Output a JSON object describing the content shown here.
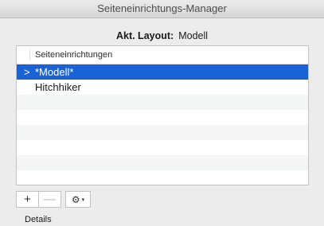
{
  "window": {
    "title": "Seiteneinrichtungs-Manager"
  },
  "current_layout": {
    "label": "Akt. Layout:",
    "value": "Modell"
  },
  "list": {
    "column_header": "Seiteneinrichtungen",
    "rows": [
      {
        "label": "*Modell*",
        "selected": true
      },
      {
        "label": "Hitchhiker",
        "selected": false
      }
    ]
  },
  "toolbar": {
    "add_label": "+",
    "remove_label": "—",
    "gear_icon": "gear-icon",
    "caret_label": "▾"
  },
  "details": {
    "label": "Details"
  },
  "colors": {
    "selection": "#1a63d6",
    "window_bg": "#ececec"
  }
}
